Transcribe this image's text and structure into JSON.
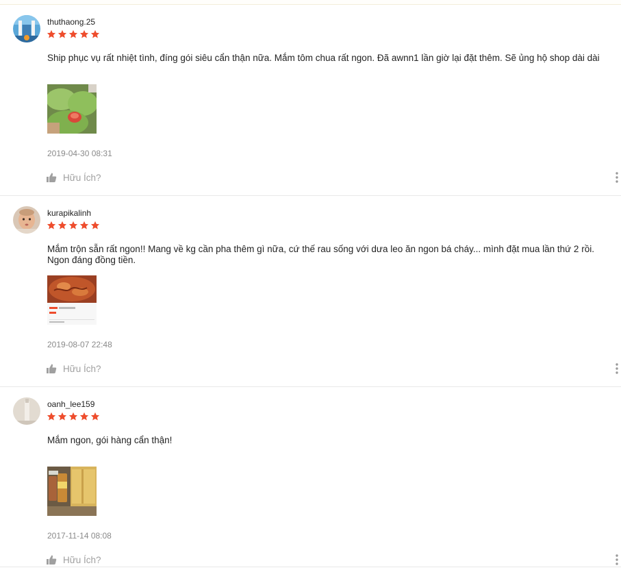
{
  "colors": {
    "star": "#ee4d2d",
    "text": "#222222",
    "muted": "#8a8a8a",
    "helpful": "#a0a0a0",
    "divider": "#e8e8e8"
  },
  "reviews": [
    {
      "username": "thuthaong.25",
      "rating": 5,
      "comment": "Ship phục vụ rất nhiệt tình, đíng gói siêu cẩn thận nữa. Mắm tôm chua rất ngon. Đã awnn1 lần giờ lại đặt thêm. Sẽ ủng hộ shop dài dài",
      "photo_icon": "lettuce-tomato-photo",
      "timestamp": "2019-04-30 08:31",
      "helpful_label": "Hữu Ích?"
    },
    {
      "username": "kurapikalinh",
      "rating": 5,
      "comment": "Mắm trộn sẵn rất ngon!! Mang về kg cần pha thêm gì nữa, cứ thế rau sống với dưa leo ăn ngon bá cháy... mình đặt mua lần thứ 2 rồi. Ngon đáng đồng tiền.",
      "photo_icon": "food-screenshot-photo",
      "timestamp": "2019-08-07 22:48",
      "helpful_label": "Hữu Ích?"
    },
    {
      "username": "oanh_lee159",
      "rating": 5,
      "comment": "Mắm ngon, gói hàng cẩn thận!",
      "photo_icon": "jars-and-box-photo",
      "timestamp": "2017-11-14 08:08",
      "helpful_label": "Hữu Ích?"
    }
  ]
}
